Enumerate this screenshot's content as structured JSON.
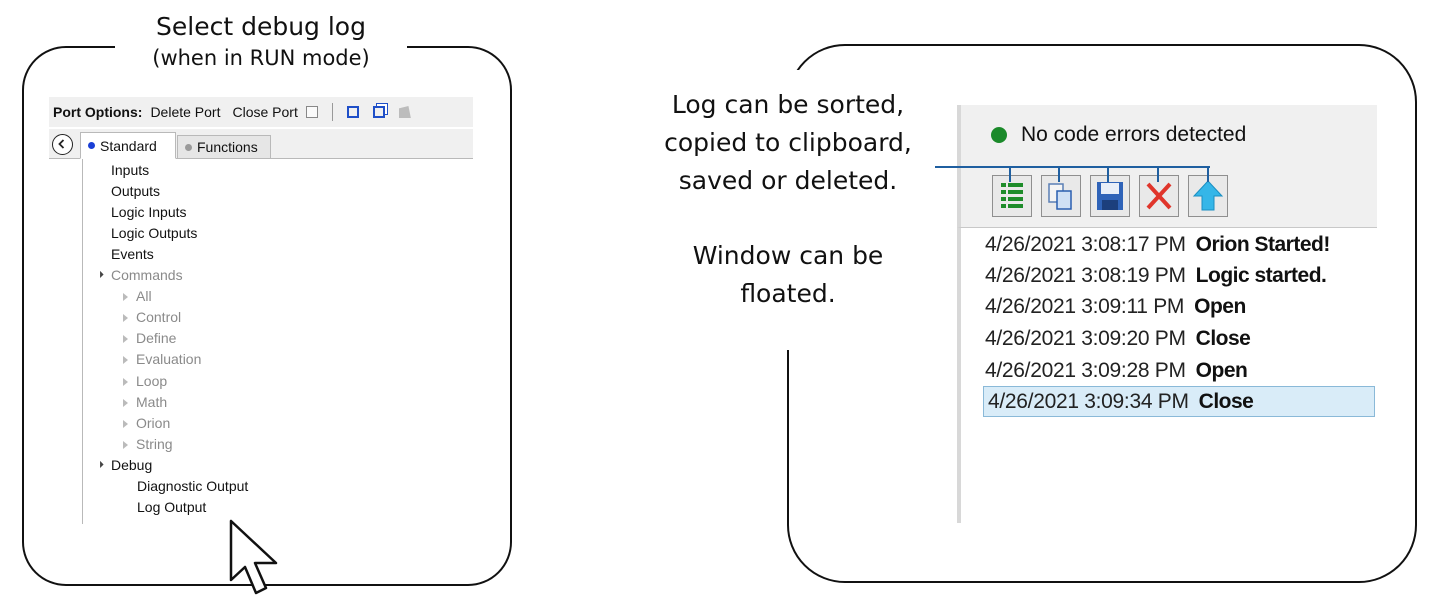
{
  "left_callout": {
    "title_line1": "Select debug log",
    "title_line2": "(when in RUN mode)"
  },
  "left_toolbar": {
    "label": "Port Options:",
    "delete_port": "Delete Port",
    "close_port": "Close Port"
  },
  "tabs": [
    {
      "label": "Standard",
      "active": true,
      "dot_color": "#1a3fd6"
    },
    {
      "label": "Functions",
      "active": false,
      "dot_color": "#9a9a9a"
    }
  ],
  "tree": {
    "top_items": [
      "Inputs",
      "Outputs",
      "Logic Inputs",
      "Logic Outputs",
      "Events"
    ],
    "commands": {
      "label": "Commands",
      "children": [
        "All",
        "Control",
        "Define",
        "Evaluation",
        "Loop",
        "Math",
        "Orion",
        "String"
      ]
    },
    "debug": {
      "label": "Debug",
      "children": [
        "Diagnostic Output",
        "Log Output"
      ]
    }
  },
  "right_callout": {
    "annotation_sort": [
      "Log can be sorted,",
      "copied to clipboard,",
      "saved or deleted."
    ],
    "annotation_float": [
      "Window can be",
      "floated."
    ]
  },
  "status": {
    "text": "No code errors detected",
    "color": "#1b8a2a"
  },
  "log_toolbar_icons": [
    "sort-icon",
    "copy-icon",
    "save-icon",
    "delete-icon",
    "float-icon"
  ],
  "log_entries": [
    {
      "timestamp": "4/26/2021 3:08:17 PM",
      "message": "Orion Started!"
    },
    {
      "timestamp": "4/26/2021 3:08:19 PM",
      "message": "Logic started."
    },
    {
      "timestamp": "4/26/2021 3:09:11 PM",
      "message": "Open"
    },
    {
      "timestamp": "4/26/2021 3:09:20 PM",
      "message": "Close"
    },
    {
      "timestamp": "4/26/2021 3:09:28 PM",
      "message": "Open"
    },
    {
      "timestamp": "4/26/2021 3:09:34 PM",
      "message": "Close",
      "selected": true
    }
  ]
}
